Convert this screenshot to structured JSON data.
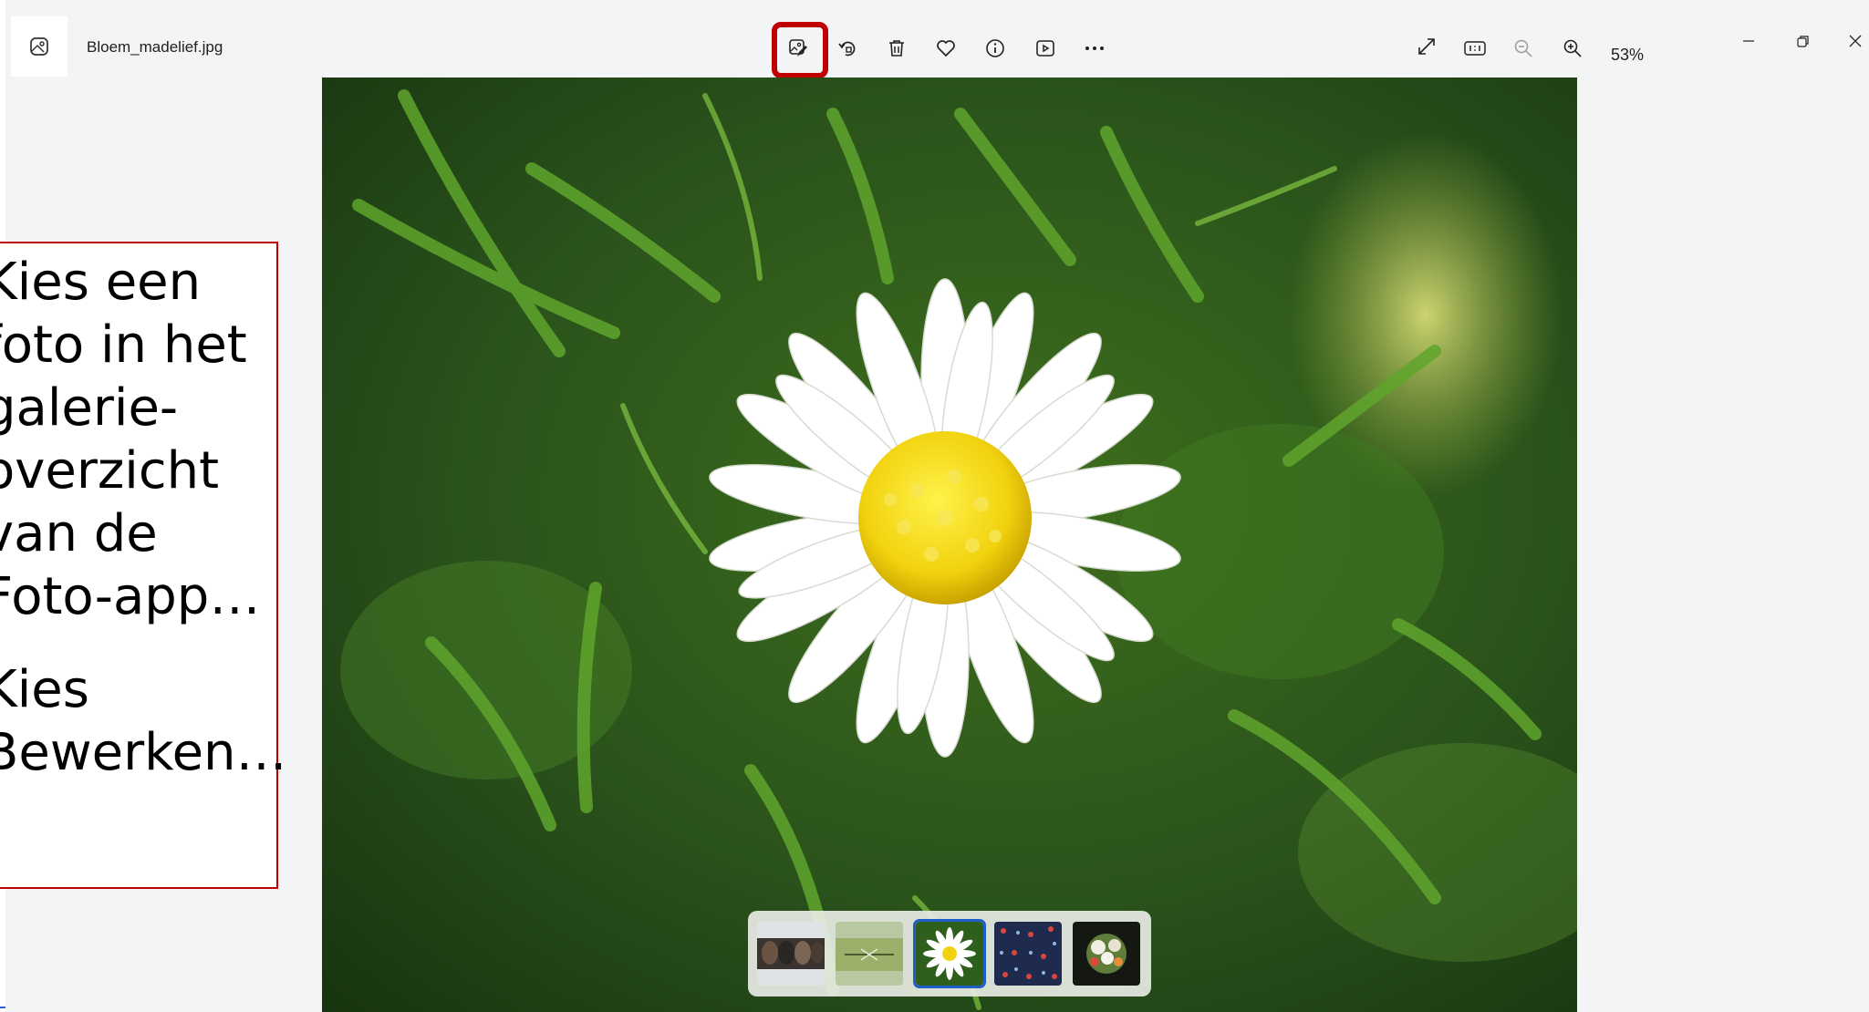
{
  "titlebar": {
    "file_name": "Bloem_madelief.jpg",
    "zoom_level": "53%"
  },
  "toolbar": {
    "center_icons": [
      "edit-image-icon",
      "rotate-icon",
      "delete-icon",
      "favorite-heart-icon",
      "info-icon",
      "slideshow-icon",
      "more-options-icon"
    ],
    "right_icons": [
      "fullscreen-icon",
      "actual-size-icon",
      "zoom-out-icon",
      "zoom-in-icon"
    ]
  },
  "window_controls": [
    "minimize-icon",
    "restore-icon",
    "close-icon"
  ],
  "callout": {
    "paragraph1_lines": [
      "Kies een",
      "foto in het",
      "galerie-",
      "overzicht",
      "van de",
      "Foto-app…"
    ],
    "paragraph2_lines": [
      "Kies",
      "Bewerken…"
    ],
    "border_color": "#c00000"
  },
  "filmstrip": {
    "thumbnails": [
      "dogs-thumbnail",
      "dragonfly-thumbnail",
      "daisy-thumbnail",
      "pattern-thumbnail",
      "bouquet-thumbnail"
    ],
    "selected_index": 2
  },
  "colors": {
    "highlight": "#c00000",
    "selection": "#1f5fc9"
  }
}
